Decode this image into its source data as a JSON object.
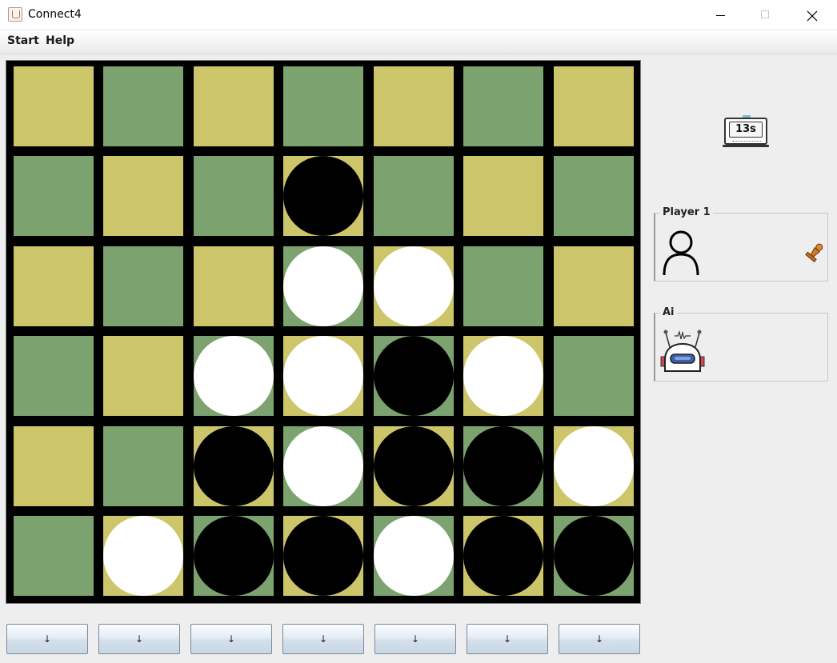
{
  "window": {
    "title": "Connect4"
  },
  "menu": {
    "items": [
      "Start",
      "Help"
    ]
  },
  "board": {
    "rows": 6,
    "cols": 7,
    "cells": [
      [
        "yellow",
        "green",
        "yellow",
        "green",
        "yellow",
        "green",
        "yellow"
      ],
      [
        "green",
        "yellow",
        "green",
        "yellow",
        "green",
        "yellow",
        "green"
      ],
      [
        "yellow",
        "green",
        "yellow",
        "green",
        "yellow",
        "green",
        "yellow"
      ],
      [
        "green",
        "yellow",
        "green",
        "yellow",
        "green",
        "yellow",
        "green"
      ],
      [
        "yellow",
        "green",
        "yellow",
        "green",
        "yellow",
        "green",
        "yellow"
      ],
      [
        "green",
        "yellow",
        "green",
        "yellow",
        "green",
        "yellow",
        "green"
      ]
    ],
    "discs": [
      [
        null,
        null,
        null,
        null,
        null,
        null,
        null
      ],
      [
        null,
        null,
        null,
        "black",
        null,
        null,
        null
      ],
      [
        null,
        null,
        null,
        "white",
        "white",
        null,
        null
      ],
      [
        null,
        null,
        "white",
        "white",
        "black",
        "white",
        null
      ],
      [
        null,
        null,
        "black",
        "white",
        "black",
        "black",
        "white"
      ],
      [
        null,
        "white",
        "black",
        "black",
        "white",
        "black",
        "black"
      ]
    ]
  },
  "drop_buttons": [
    "↓",
    "↓",
    "↓",
    "↓",
    "↓",
    "↓",
    "↓"
  ],
  "timer": {
    "text": "13s"
  },
  "player_panel": {
    "title": "Player 1",
    "avatar": "person-icon",
    "piece_icon": "pawn-icon"
  },
  "ai_panel": {
    "title": "Ai",
    "avatar": "robot-icon"
  },
  "colors": {
    "yellow": "#ccc56a",
    "green": "#7ba26f",
    "grid": "#000000",
    "white_disc": "#ffffff",
    "black_disc": "#000000"
  }
}
